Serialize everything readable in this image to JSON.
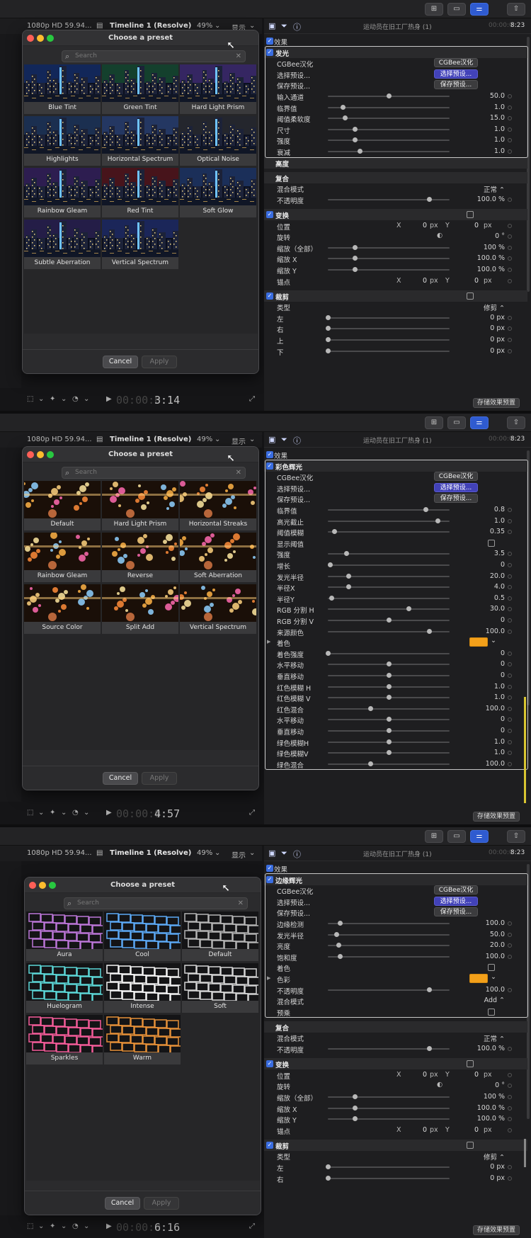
{
  "viewer": {
    "format": "1080p HD 59.94...",
    "timeline": "Timeline 1 (Resolve)",
    "zoom": "49%",
    "zoom_arrow": "⌄",
    "display": "显示",
    "display_arrow": "⌄"
  },
  "inspector_head": {
    "title": "运动员在旧工厂热身 (1)",
    "duration_dim": "00:00:0",
    "duration": "8:23"
  },
  "toolbar_icons": [
    "film-icon",
    "filter-icon",
    "info-icon"
  ],
  "save_preset_label": "存储效果预置",
  "frames": [
    {
      "dialog": {
        "title": "Choose a preset",
        "search_placeholder": "Search",
        "cancel": "Cancel",
        "apply": "Apply",
        "presets": [
          "Blue Tint",
          "Green Tint",
          "Hard Light Prism",
          "Highlights",
          "Horizontal Spectrum",
          "Optical Noise",
          "Rainbow Gleam",
          "Red Tint",
          "Soft Glow",
          "Subtle Aberration",
          "Vertical Spectrum"
        ]
      },
      "timecode_dim": "00:00:0",
      "timecode": "3:14",
      "rows": [
        {
          "t": "hdr",
          "lbl": "效果",
          "check": true
        },
        {
          "t": "sec",
          "lbl": "发光",
          "check": true
        },
        {
          "t": "pill",
          "lbl": "CGBee汉化",
          "pill": "CGBee汉化",
          "pc": "g"
        },
        {
          "t": "pill",
          "lbl": "选择预设...",
          "pill": "选择预设...",
          "pc": "b"
        },
        {
          "t": "pill",
          "lbl": "保存预设...",
          "pill": "保存预设...",
          "pc": "g"
        },
        {
          "t": "sl",
          "lbl": "输入通道",
          "val": "50.0",
          "k": 0.5
        },
        {
          "t": "sl",
          "lbl": "临界值",
          "val": "1.0",
          "k": 0.12
        },
        {
          "t": "sl",
          "lbl": "阈值柔软度",
          "val": "15.0",
          "k": 0.14
        },
        {
          "t": "sl",
          "lbl": "尺寸",
          "val": "1.0",
          "k": 0.22
        },
        {
          "t": "sl",
          "lbl": "强度",
          "val": "1.0",
          "k": 0.22
        },
        {
          "t": "sl",
          "lbl": "衰减",
          "val": "1.0",
          "k": 0.26
        },
        {
          "t": "plain",
          "lbl": "高度"
        },
        {
          "t": "gap"
        },
        {
          "t": "plain",
          "lbl": "复合"
        },
        {
          "t": "sel",
          "lbl": "混合模式",
          "val": "正常 ⌃"
        },
        {
          "t": "sl",
          "lbl": "不透明度",
          "val": "100.0 %",
          "k": 0.83
        },
        {
          "t": "gap"
        },
        {
          "t": "secb",
          "lbl": "变换",
          "check": true
        },
        {
          "t": "xy",
          "lbl": "位置",
          "x": "0",
          "y": "0",
          "u": "px"
        },
        {
          "t": "rot",
          "lbl": "旋转",
          "val": "0 °"
        },
        {
          "t": "sl",
          "lbl": "缩放（全部）",
          "val": "100 %",
          "k": 0.22
        },
        {
          "t": "sl",
          "lbl": "缩放 X",
          "val": "100.0 %",
          "k": 0.22
        },
        {
          "t": "sl",
          "lbl": "缩放 Y",
          "val": "100.0 %",
          "k": 0.22
        },
        {
          "t": "xy",
          "lbl": "锚点",
          "x": "0",
          "y": "0",
          "u": "px"
        },
        {
          "t": "gap"
        },
        {
          "t": "secb",
          "lbl": "裁剪",
          "check": true
        },
        {
          "t": "sel",
          "lbl": "类型",
          "val": "修剪 ⌃"
        },
        {
          "t": "sl",
          "lbl": "左",
          "val": "0 px",
          "k": 0.0
        },
        {
          "t": "sl",
          "lbl": "右",
          "val": "0 px",
          "k": 0.0
        },
        {
          "t": "sl",
          "lbl": "上",
          "val": "0 px",
          "k": 0.0
        },
        {
          "t": "sl",
          "lbl": "下",
          "val": "0 px",
          "k": 0.0
        }
      ]
    },
    {
      "dialog": {
        "title": "Choose a preset",
        "search_placeholder": "Search",
        "cancel": "Cancel",
        "apply": "Apply",
        "presets": [
          "Default",
          "Hard Light Prism",
          "Horizontal Streaks",
          "Rainbow Gleam",
          "Reverse",
          "Soft Aberration",
          "Source Color",
          "Split Add",
          "Vertical Spectrum"
        ]
      },
      "timecode_dim": "00:00:0",
      "timecode": "4:57",
      "rows": [
        {
          "t": "hdr",
          "lbl": "效果",
          "check": true
        },
        {
          "t": "sec",
          "lbl": "彩色辉光",
          "check": true
        },
        {
          "t": "pill",
          "lbl": "CGBee汉化",
          "pill": "CGBee汉化",
          "pc": "g"
        },
        {
          "t": "pill",
          "lbl": "选择预设...",
          "pill": "选择预设...",
          "pc": "b"
        },
        {
          "t": "pill",
          "lbl": "保存预设...",
          "pill": "保存预设...",
          "pc": "g"
        },
        {
          "t": "sl",
          "lbl": "临界值",
          "val": "0.8",
          "k": 0.8
        },
        {
          "t": "sl",
          "lbl": "高光截止",
          "val": "1.0",
          "k": 0.9
        },
        {
          "t": "sl",
          "lbl": "阈值模糊",
          "val": "0.35",
          "k": 0.05
        },
        {
          "t": "chk",
          "lbl": "显示阈值"
        },
        {
          "t": "sl",
          "lbl": "强度",
          "val": "3.5",
          "k": 0.15
        },
        {
          "t": "sl",
          "lbl": "增长",
          "val": "0",
          "k": 0.02
        },
        {
          "t": "sl",
          "lbl": "发光半径",
          "val": "20.0",
          "k": 0.17
        },
        {
          "t": "sl",
          "lbl": "半径X",
          "val": "4.0",
          "k": 0.17
        },
        {
          "t": "sl",
          "lbl": "半径Y",
          "val": "0.5",
          "k": 0.03
        },
        {
          "t": "sl",
          "lbl": "RGB 分割 H",
          "val": "30.0",
          "k": 0.66
        },
        {
          "t": "sl",
          "lbl": "RGB 分割 V",
          "val": "0",
          "k": 0.5
        },
        {
          "t": "sl",
          "lbl": "来源颜色",
          "val": "100.0",
          "k": 0.83
        },
        {
          "t": "color",
          "lbl": "着色"
        },
        {
          "t": "sl",
          "lbl": "着色强度",
          "val": "0",
          "k": 0.0
        },
        {
          "t": "sl",
          "lbl": "水平移动",
          "val": "0",
          "k": 0.5
        },
        {
          "t": "sl",
          "lbl": "垂直移动",
          "val": "0",
          "k": 0.5
        },
        {
          "t": "sl",
          "lbl": "红色模糊 H",
          "val": "1.0",
          "k": 0.5
        },
        {
          "t": "sl",
          "lbl": "红色模糊 V",
          "val": "1.0",
          "k": 0.5
        },
        {
          "t": "sl",
          "lbl": "红色混合",
          "val": "100.0",
          "k": 0.35
        },
        {
          "t": "sl",
          "lbl": "水平移动",
          "val": "0",
          "k": 0.5
        },
        {
          "t": "sl",
          "lbl": "垂直移动",
          "val": "0",
          "k": 0.5
        },
        {
          "t": "sl",
          "lbl": "绿色模糊H",
          "val": "1.0",
          "k": 0.5
        },
        {
          "t": "sl",
          "lbl": "绿色模糊V",
          "val": "1.0",
          "k": 0.5
        },
        {
          "t": "sl",
          "lbl": "绿色混合",
          "val": "100.0",
          "k": 0.35
        }
      ]
    },
    {
      "dialog": {
        "title": "Choose a preset",
        "search_placeholder": "Search",
        "cancel": "Cancel",
        "apply": "Apply",
        "presets": [
          "Aura",
          "Cool",
          "Default",
          "Huelogram",
          "Intense",
          "Soft",
          "Sparkles",
          "Warm"
        ]
      },
      "timecode_dim": "00:00:0",
      "timecode": "6:16",
      "rows": [
        {
          "t": "hdr",
          "lbl": "效果",
          "check": true
        },
        {
          "t": "sec",
          "lbl": "边缘辉光",
          "check": true
        },
        {
          "t": "pill",
          "lbl": "CGBee汉化",
          "pill": "CGBee汉化",
          "pc": "g"
        },
        {
          "t": "pill",
          "lbl": "选择预设...",
          "pill": "选择预设...",
          "pc": "b"
        },
        {
          "t": "pill",
          "lbl": "保存预设...",
          "pill": "保存预设...",
          "pc": "g"
        },
        {
          "t": "sl",
          "lbl": "边缘检测",
          "val": "100.0",
          "k": 0.1
        },
        {
          "t": "sl",
          "lbl": "发光半径",
          "val": "50.0",
          "k": 0.07
        },
        {
          "t": "sl",
          "lbl": "亮度",
          "val": "20.0",
          "k": 0.09
        },
        {
          "t": "sl",
          "lbl": "饱和度",
          "val": "100.0",
          "k": 0.1
        },
        {
          "t": "chk",
          "lbl": "着色"
        },
        {
          "t": "color",
          "lbl": "色彩"
        },
        {
          "t": "sl",
          "lbl": "不透明度",
          "val": "100.0",
          "k": 0.83
        },
        {
          "t": "sel",
          "lbl": "混合模式",
          "val": "Add ⌃"
        },
        {
          "t": "chk",
          "lbl": "预乘"
        },
        {
          "t": "gap"
        },
        {
          "t": "plain",
          "lbl": "复合"
        },
        {
          "t": "sel",
          "lbl": "混合模式",
          "val": "正常 ⌃"
        },
        {
          "t": "sl",
          "lbl": "不透明度",
          "val": "100.0 %",
          "k": 0.83
        },
        {
          "t": "gap"
        },
        {
          "t": "secb",
          "lbl": "变换",
          "check": true
        },
        {
          "t": "xy",
          "lbl": "位置",
          "x": "0",
          "y": "0",
          "u": "px"
        },
        {
          "t": "rot",
          "lbl": "旋转",
          "val": "0 °"
        },
        {
          "t": "sl",
          "lbl": "缩放（全部）",
          "val": "100 %",
          "k": 0.22
        },
        {
          "t": "sl",
          "lbl": "缩放 X",
          "val": "100.0 %",
          "k": 0.22
        },
        {
          "t": "sl",
          "lbl": "缩放 Y",
          "val": "100.0 %",
          "k": 0.22
        },
        {
          "t": "xy",
          "lbl": "锚点",
          "x": "0",
          "y": "0",
          "u": "px"
        },
        {
          "t": "gap"
        },
        {
          "t": "secb",
          "lbl": "裁剪",
          "check": true
        },
        {
          "t": "sel",
          "lbl": "类型",
          "val": "修剪 ⌃"
        },
        {
          "t": "sl",
          "lbl": "左",
          "val": "0 px",
          "k": 0.0
        },
        {
          "t": "sl",
          "lbl": "右",
          "val": "0 px",
          "k": 0.0
        }
      ]
    }
  ]
}
